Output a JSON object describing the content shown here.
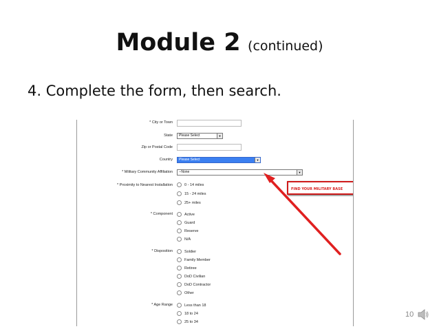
{
  "slide": {
    "title": "Module 2",
    "title_suffix": "(continued)",
    "bullet": "4. Complete the form, then search.",
    "page_number": "10"
  },
  "form": {
    "city_label": "* City or Town",
    "state_label": "State",
    "state_value": "Please Select",
    "zip_label": "Zip or Postal Code",
    "country_label": "Country",
    "country_value": "Please Select",
    "affiliation_label": "* Military Community Affiliation",
    "affiliation_value": "--None",
    "proximity_label": "* Proximity to Nearest Installation",
    "proximity_options": [
      "0 - 14 miles",
      "15 - 24 miles",
      "25+ miles"
    ],
    "component_label": "* Component",
    "component_options": [
      "Active",
      "Guard",
      "Reserve",
      "N/A"
    ],
    "disposition_label": "* Disposition",
    "disposition_options": [
      "Soldier",
      "Family Member",
      "Retiree",
      "DoD Civilian",
      "DoD Contractor",
      "Other"
    ],
    "age_label": "* Age Range",
    "age_options": [
      "Less than 18",
      "18 to 24",
      "25 to 34"
    ]
  },
  "callout": {
    "text": "Find your military base",
    "color": "#d81f1f"
  },
  "icons": {
    "speaker": "speaker-icon"
  }
}
